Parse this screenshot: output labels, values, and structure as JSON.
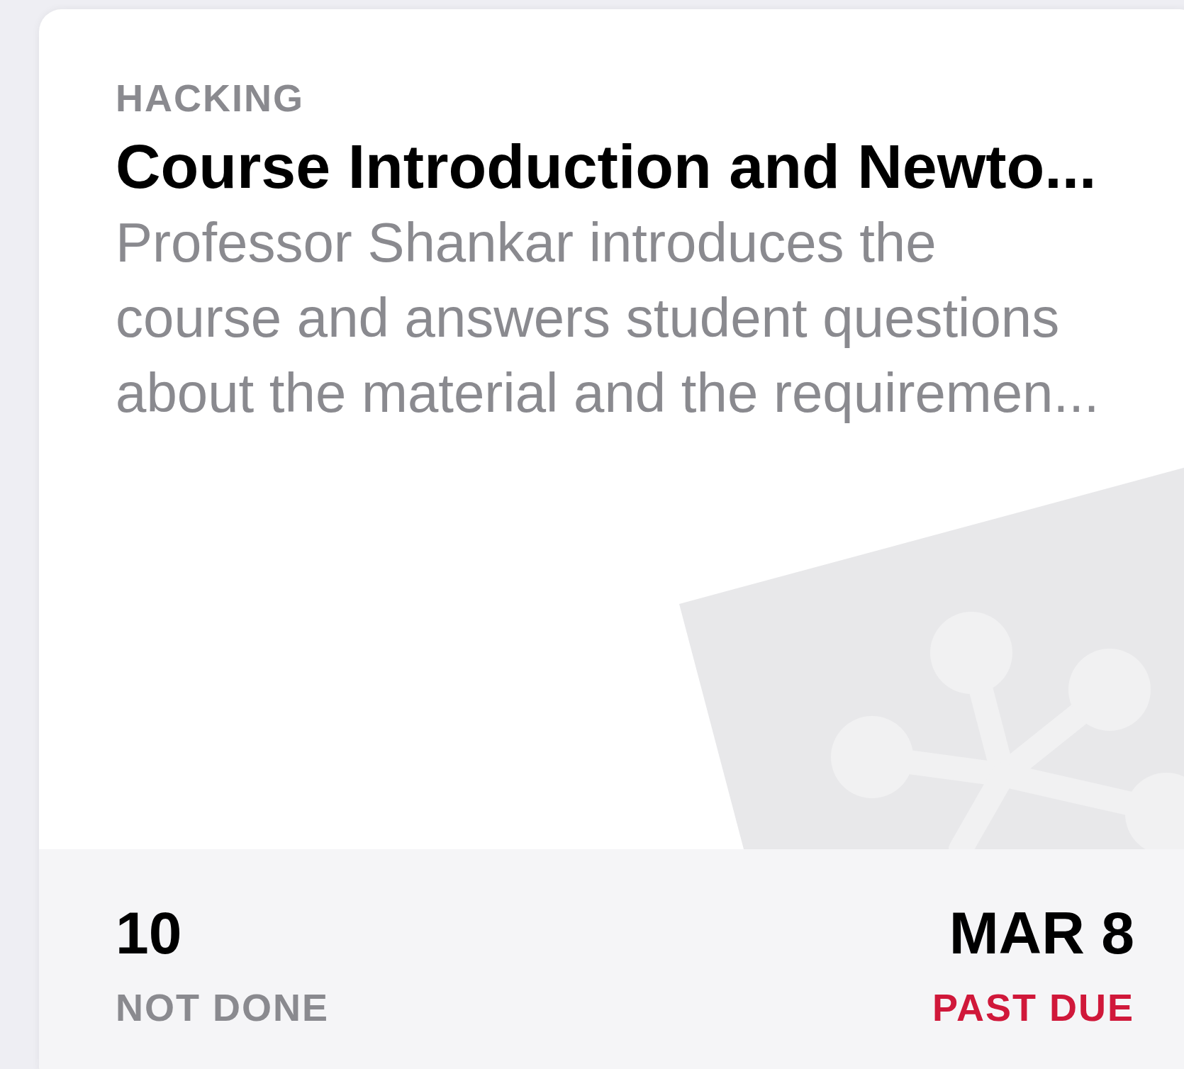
{
  "card": {
    "category": "HACKING",
    "title": "Course Introduction and Newto...",
    "description": "Professor Shankar introduces the course and answers student questions about the material and the requiremen...",
    "footer": {
      "count": "10",
      "count_label": "NOT DONE",
      "due_date": "MAR 8",
      "due_label": "PAST DUE",
      "past_due": true
    }
  }
}
